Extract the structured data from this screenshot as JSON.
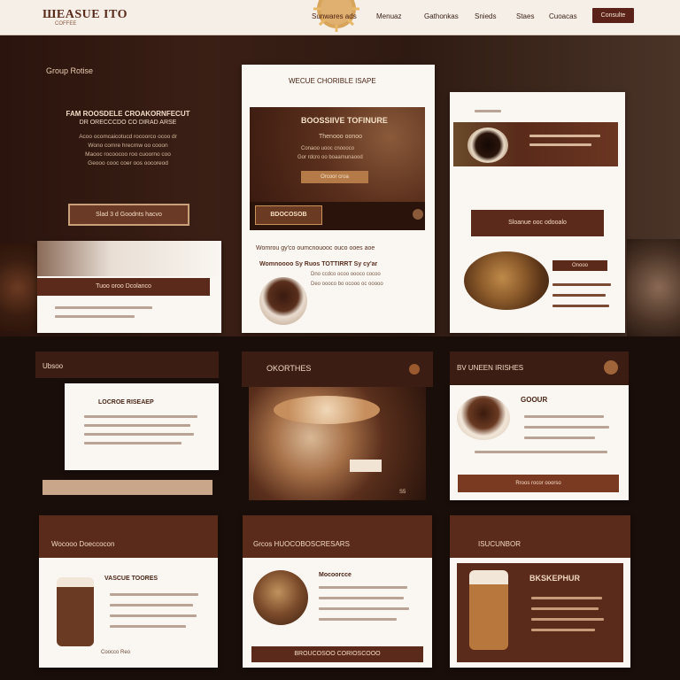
{
  "header": {
    "logo": "ШЕАSUE ITO",
    "logo_sub": "COFFEE",
    "seal_text": "Sunwares ads",
    "nav": [
      "Menuaz",
      "Gathonkas",
      "Snieds",
      "Staes",
      "Cuoacas"
    ],
    "cta": "Consulte"
  },
  "hero": {
    "kicker": "Group Rotise",
    "headline": "FAM ROOSDELE CROAKORNFECUT",
    "headline2": "DR ORECCCDO CO DIRAD ARSE",
    "paragraph": [
      "Acoo ocomcaicotucd rocoorco ocoo dr",
      "Wono comre hrecrnw oo cooon",
      "Maooc rocoocoo roo cuoorno coo",
      "Geooo cooc coer oos oocoreod"
    ],
    "button": "Slad 3 d Goodnts hacvo"
  },
  "card_left_small": {
    "band": "Tuoo oroo  Dcolanco"
  },
  "card_center_top": {
    "kicker": "WECUE CHORIBLE ISAPE",
    "headline": "BOOSSIIVE TOFINURE",
    "sub": "Thenooo oonoo",
    "lines": [
      "Conaoo uooc cnoooco",
      "Gor rdcro oo boaamunaood"
    ],
    "btn": "Orcoor croa",
    "badge": "BDOCOSOB",
    "body1": "Womrou gy'co oumcnouooc ouco ooes aoe",
    "body2": "Womnoooo Sy Ruos TOTTIRRT Sy cy'ar",
    "body3": "Dno ccdco ocoo oooco cocoo",
    "body4": "Deo oooco bo ocooo oc ooooo"
  },
  "card_right_top": {
    "band": "Sloanue  ooc odooalo",
    "tag": "Onooo"
  },
  "row2": [
    {
      "title": "Ubsoo",
      "inner_title": "LOCROE RISEAEP",
      "btn": ""
    },
    {
      "title": "OKORTHES",
      "btn": "",
      "foot": "S5"
    },
    {
      "title": "BV UNEEN IRISHES",
      "inner_title": "GOOUR",
      "btn": "Rroos rocor ooorso"
    }
  ],
  "row3": [
    {
      "title": "Wocooo Doeccocon",
      "inner_title": "VASCUE TOORES",
      "btn": "Coocco Reo"
    },
    {
      "title": "Grcos HUOCOBOSCRESARS",
      "inner_title": "Mocoorcce",
      "btn": "BROUCOSOO CORIOSCOOO"
    },
    {
      "title": "ISUCUNBOR",
      "inner_title": "BKSKEPHUR",
      "btn": ""
    }
  ],
  "colors": {
    "brand_dark": "#3b1d13",
    "brand": "#5c2a1a",
    "cream": "#faf6f1",
    "accent": "#c98a4a"
  },
  "icons": [
    "coffee-bean-icon",
    "coffee-cup-icon",
    "menu-icon"
  ]
}
